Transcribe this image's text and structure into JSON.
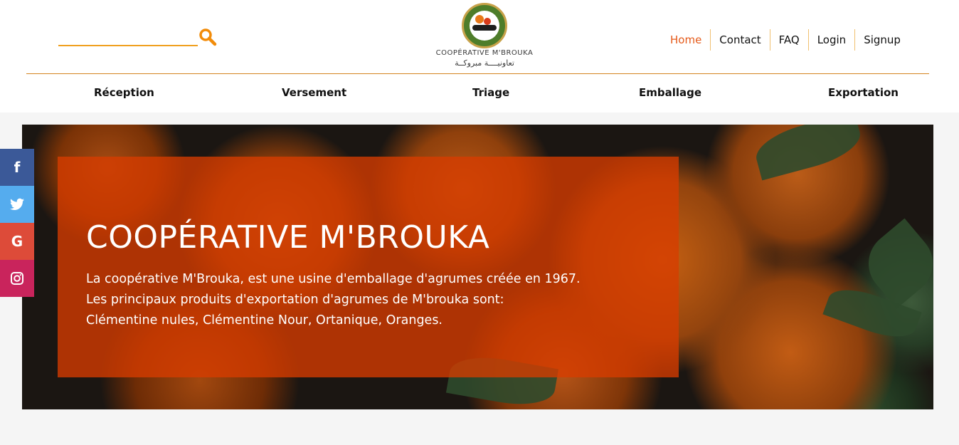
{
  "search": {
    "placeholder": ""
  },
  "logo": {
    "name": "COOPÉRATIVE M'BROUKA",
    "arabic": "تعاونيــــة مبروكــة"
  },
  "top_nav": [
    {
      "label": "Home",
      "active": true
    },
    {
      "label": "Contact"
    },
    {
      "label": "FAQ"
    },
    {
      "label": "Login"
    },
    {
      "label": "Signup"
    }
  ],
  "menu": [
    "Réception",
    "Versement",
    "Triage",
    "Emballage",
    "Exportation"
  ],
  "hero": {
    "title": "COOPÉRATIVE M'BROUKA",
    "lines": [
      "La coopérative M'Brouka, est une usine d'emballage d'agrumes créée en 1967.",
      "Les principaux produits d'exportation d'agrumes de M'brouka sont:",
      "Clémentine nules, Clémentine Nour, Ortanique, Oranges."
    ]
  },
  "social": [
    {
      "icon": "facebook-icon",
      "glyph": "f",
      "color": "#3b5998"
    },
    {
      "icon": "twitter-icon",
      "glyph": "🐦",
      "color": "#55acee"
    },
    {
      "icon": "google-icon",
      "glyph": "G",
      "color": "#dd4b39"
    },
    {
      "icon": "instagram-icon",
      "glyph": "◎",
      "color": "#c9245c"
    }
  ],
  "colors": {
    "accent": "#e55a1a",
    "divider": "#d4831e",
    "search_line": "#f0a020",
    "hero_box": "#d73c00"
  }
}
